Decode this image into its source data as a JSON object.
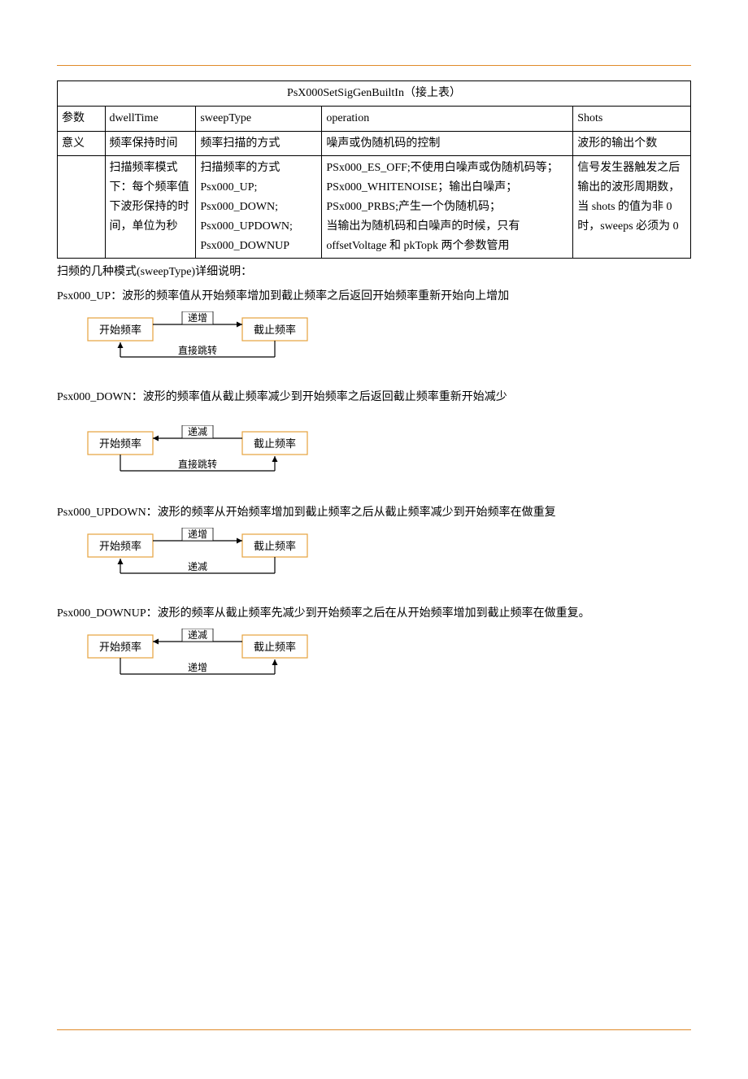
{
  "table": {
    "title": "PsX000SetSigGenBuiltIn（接上表）",
    "headerRow": [
      "参数",
      "dwellTime",
      "sweepType",
      "operation",
      "Shots"
    ],
    "meaningLabel": "意义",
    "meaningRow": [
      "频率保持时间",
      "频率扫描的方式",
      "噪声或伪随机码的控制",
      "波形的输出个数"
    ],
    "detailRow": [
      "扫描频率模式下：每个频率值下波形保持的时间，单位为秒",
      "扫描频率的方式 Psx000_UP; Psx000_DOWN; Psx000_UPDOWN; Psx000_DOWNUP",
      "PSx000_ES_OFF;不使用白噪声或伪随机码等；\nPSx000_WHITENOISE；输出白噪声；\nPSx000_PRBS;产生一个伪随机码；\n当输出为随机码和白噪声的时候，只有 offsetVoltage 和 pkTopk 两个参数管用",
      "信号发生器触发之后输出的波形周期数，当 shots 的值为非 0 时，sweeps 必须为 0"
    ]
  },
  "notes": {
    "intro": "扫频的几种模式(sweepType)详细说明：",
    "modes": [
      {
        "label": "Psx000_UP：",
        "desc": "波形的频率值从开始频率增加到截止频率之后返回开始频率重新开始向上增加"
      },
      {
        "label": "Psx000_DOWN：",
        "desc": "波形的频率值从截止频率减少到开始频率之后返回截止频率重新开始减少"
      },
      {
        "label": "Psx000_UPDOWN：",
        "desc": "波形的频率从开始频率增加到截止频率之后从截止频率减少到开始频率在做重复"
      },
      {
        "label": "Psx000_DOWNUP：",
        "desc": "波形的频率从截止频率先减少到开始频率之后在从开始频率增加到截止频率在做重复。"
      }
    ]
  },
  "diagram": {
    "startFreq": "开始频率",
    "endFreq": "截止频率",
    "increase": "递增",
    "decrease": "递减",
    "jump": "直接跳转"
  }
}
